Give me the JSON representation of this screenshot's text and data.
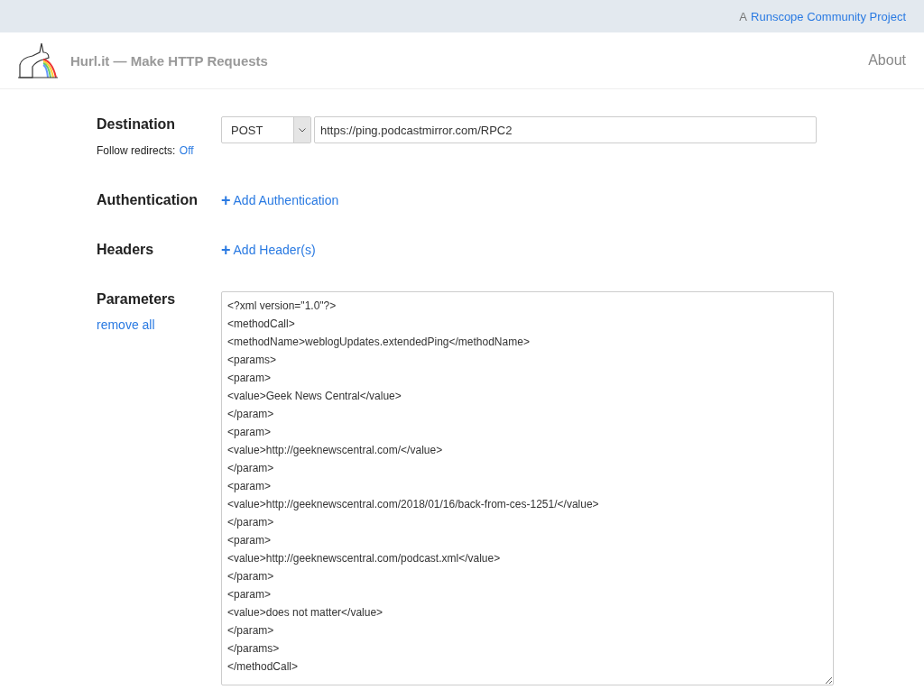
{
  "top_bar": {
    "prefix": "A",
    "link": "Runscope Community Project"
  },
  "header": {
    "title": "Hurl.it — Make HTTP Requests",
    "nav": "About"
  },
  "destination": {
    "label": "Destination",
    "method": "POST",
    "url": "https://ping.podcastmirror.com/RPC2",
    "follow_redirects_label": "Follow redirects:",
    "follow_redirects_value": "Off"
  },
  "authentication": {
    "label": "Authentication",
    "action_icon": "+",
    "action": "Add Authentication"
  },
  "headers": {
    "label": "Headers",
    "action_icon": "+",
    "action": "Add Header(s)"
  },
  "parameters": {
    "label": "Parameters",
    "remove": "remove all",
    "lines": [
      "<?xml version=\"1.0\"?>",
      "<methodCall>",
      "<methodName>weblogUpdates.extendedPing</methodName>",
      "<params>",
      "<param>",
      "<value>Geek News Central</value>",
      "</param>",
      "<param>",
      "<value>http://geeknewscentral.com/</value>",
      "</param>",
      "<param>",
      "<value>http://geeknewscentral.com/2018/01/16/back-from-ces-1251/</value>",
      "</param>",
      "<param>",
      "<value>http://geeknewscentral.com/podcast.xml</value>",
      "</param>",
      "<param>",
      "<value>does not matter</value>",
      "</param>",
      "</params>",
      "</methodCall>"
    ]
  }
}
